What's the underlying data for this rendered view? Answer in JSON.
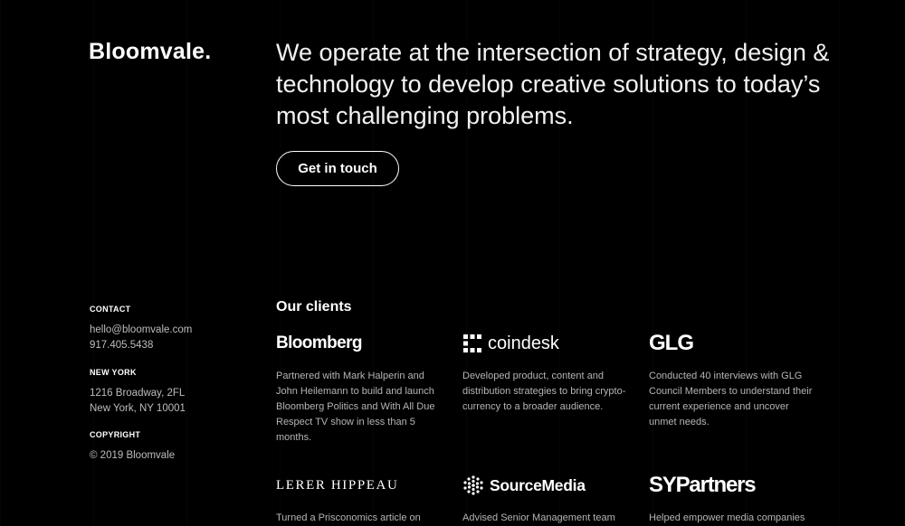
{
  "brand": {
    "name": "Bloomvale",
    "dot": "."
  },
  "hero": {
    "statement": "We operate at the intersection of strategy, design & technology to develop creative solutions to today’s most challenging problems.",
    "cta_label": "Get in touch"
  },
  "sidebar": {
    "contact": {
      "heading": "CONTACT",
      "email": "hello@bloomvale.com",
      "phone": "917.405.5438"
    },
    "office": {
      "heading": "NEW YORK",
      "address_line1": "1216 Broadway, 2FL",
      "address_line2": "New York, NY 10001"
    },
    "copyright": {
      "heading": "COPYRIGHT",
      "text": "© 2019 Bloomvale"
    }
  },
  "clients": {
    "title": "Our clients",
    "items": [
      {
        "logo_text": "Bloomberg",
        "description": "Partnered with Mark Halperin and John Heilemann to build and launch Bloomberg Politics and With All Due Respect TV show in less than 5 months."
      },
      {
        "logo_text": "coindesk",
        "logo_icon": "coindesk-mark-icon",
        "description": "Developed product, content and distribution strategies to bring crypto-currency to a broader audience."
      },
      {
        "logo_text": "GLG",
        "description": "Conducted 40 interviews with GLG Council Members to understand their current experience and uncover unmet needs."
      },
      {
        "logo_text": "LERER HIPPEAU",
        "description": "Turned a Prisconomics article on"
      },
      {
        "logo_text": "SourceMedia",
        "logo_icon": "sourcemedia-grid-icon",
        "description": "Advised Senior Management team"
      },
      {
        "logo_text": "SYPartners",
        "description": "Helped empower media companies"
      }
    ]
  }
}
